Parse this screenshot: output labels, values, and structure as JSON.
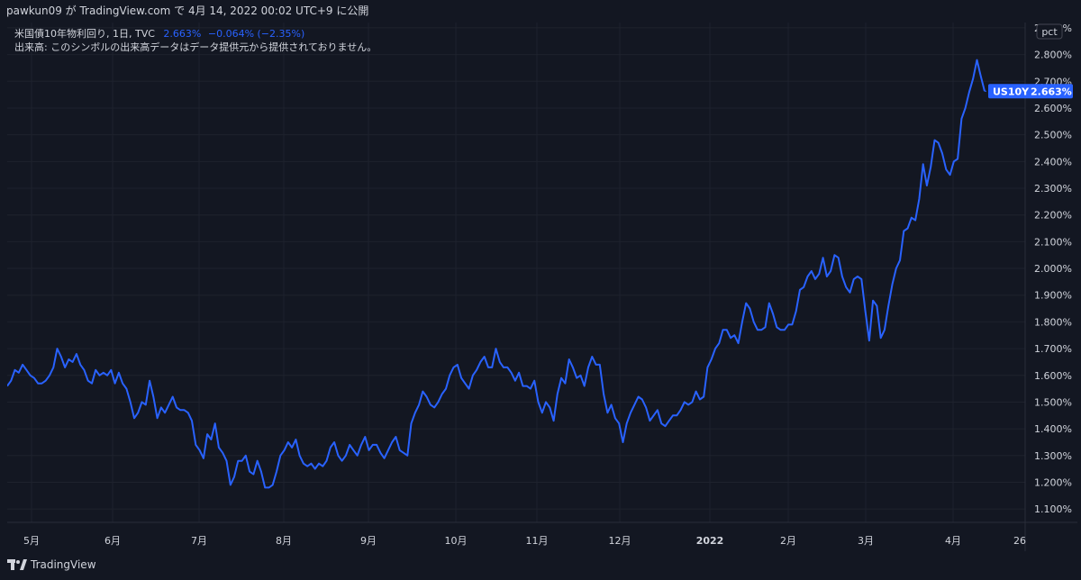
{
  "header": {
    "publisher_line": "pawkun09 が TradingView.com で 4月 14, 2022 00:02 UTC+9 に公開"
  },
  "legend": {
    "symbol_info": "米国債10年物利回り, 1日, TVC",
    "last_value": "2.663%",
    "change": "−0.064% (−2.35%)",
    "volume_note": "出来高: このシンボルの出来高データはデータ提供元から提供されておりません。"
  },
  "price_scale": {
    "unit_button": "pct",
    "tick_labels": [
      "1.100%",
      "1.200%",
      "1.300%",
      "1.400%",
      "1.500%",
      "1.600%",
      "1.700%",
      "1.800%",
      "1.900%",
      "2.000%",
      "2.100%",
      "2.200%",
      "2.300%",
      "2.400%",
      "2.500%",
      "2.600%",
      "2.700%",
      "2.800%",
      "2.900%"
    ],
    "price_tag_symbol": "US10Y",
    "price_tag_value": "2.663%"
  },
  "footer": {
    "brand": "TradingView"
  },
  "colors": {
    "background": "#131722",
    "line": "#2962ff",
    "grid": "#1f2430",
    "text": "#d1d4dc"
  },
  "chart_data": {
    "type": "line",
    "title": "米国債10年物利回り, 1日, TVC",
    "ylabel": "",
    "xlabel": "",
    "y_unit": "%",
    "ylim": [
      1.05,
      2.92
    ],
    "x_tick_labels": [
      "5月",
      "6月",
      "7月",
      "8月",
      "9月",
      "10月",
      "11月",
      "12月",
      "2022",
      "2月",
      "3月",
      "4月",
      "26"
    ],
    "grid": true,
    "series": [
      {
        "values": [
          1.56,
          1.58,
          1.62,
          1.61,
          1.64,
          1.62,
          1.6,
          1.59,
          1.57,
          1.57,
          1.58,
          1.6,
          1.63,
          1.7,
          1.67,
          1.63,
          1.66,
          1.65,
          1.68,
          1.64,
          1.62,
          1.58,
          1.57,
          1.62,
          1.6,
          1.61,
          1.6,
          1.62,
          1.57,
          1.61,
          1.57,
          1.55,
          1.5,
          1.44,
          1.46,
          1.5,
          1.49,
          1.58,
          1.52,
          1.44,
          1.48,
          1.46,
          1.49,
          1.52,
          1.48,
          1.47,
          1.47,
          1.46,
          1.43,
          1.34,
          1.32,
          1.29,
          1.38,
          1.36,
          1.42,
          1.33,
          1.31,
          1.28,
          1.19,
          1.22,
          1.28,
          1.28,
          1.3,
          1.24,
          1.23,
          1.28,
          1.24,
          1.18,
          1.18,
          1.19,
          1.24,
          1.3,
          1.32,
          1.35,
          1.33,
          1.36,
          1.3,
          1.27,
          1.26,
          1.27,
          1.25,
          1.27,
          1.26,
          1.28,
          1.33,
          1.35,
          1.3,
          1.28,
          1.3,
          1.34,
          1.32,
          1.3,
          1.34,
          1.37,
          1.32,
          1.34,
          1.34,
          1.31,
          1.29,
          1.32,
          1.35,
          1.37,
          1.32,
          1.31,
          1.3,
          1.42,
          1.46,
          1.49,
          1.54,
          1.52,
          1.49,
          1.48,
          1.5,
          1.53,
          1.55,
          1.6,
          1.63,
          1.64,
          1.59,
          1.57,
          1.55,
          1.6,
          1.62,
          1.65,
          1.67,
          1.63,
          1.63,
          1.7,
          1.65,
          1.63,
          1.63,
          1.61,
          1.58,
          1.61,
          1.56,
          1.56,
          1.55,
          1.58,
          1.5,
          1.46,
          1.5,
          1.48,
          1.43,
          1.53,
          1.59,
          1.57,
          1.66,
          1.63,
          1.59,
          1.6,
          1.56,
          1.63,
          1.67,
          1.64,
          1.64,
          1.53,
          1.46,
          1.49,
          1.44,
          1.42,
          1.35,
          1.42,
          1.46,
          1.49,
          1.52,
          1.51,
          1.48,
          1.43,
          1.45,
          1.47,
          1.42,
          1.41,
          1.43,
          1.45,
          1.45,
          1.47,
          1.5,
          1.49,
          1.5,
          1.54,
          1.51,
          1.52,
          1.63,
          1.66,
          1.7,
          1.72,
          1.77,
          1.77,
          1.74,
          1.75,
          1.72,
          1.8,
          1.87,
          1.85,
          1.8,
          1.77,
          1.77,
          1.78,
          1.87,
          1.83,
          1.78,
          1.77,
          1.77,
          1.79,
          1.79,
          1.84,
          1.92,
          1.93,
          1.97,
          1.99,
          1.96,
          1.98,
          2.04,
          1.97,
          1.99,
          2.05,
          2.04,
          1.97,
          1.93,
          1.91,
          1.96,
          1.97,
          1.96,
          1.84,
          1.73,
          1.88,
          1.86,
          1.74,
          1.77,
          1.86,
          1.94,
          2.0,
          2.03,
          2.14,
          2.15,
          2.19,
          2.18,
          2.26,
          2.39,
          2.31,
          2.38,
          2.48,
          2.47,
          2.43,
          2.37,
          2.35,
          2.4,
          2.41,
          2.56,
          2.6,
          2.66,
          2.71,
          2.78,
          2.72,
          2.663
        ]
      }
    ]
  }
}
